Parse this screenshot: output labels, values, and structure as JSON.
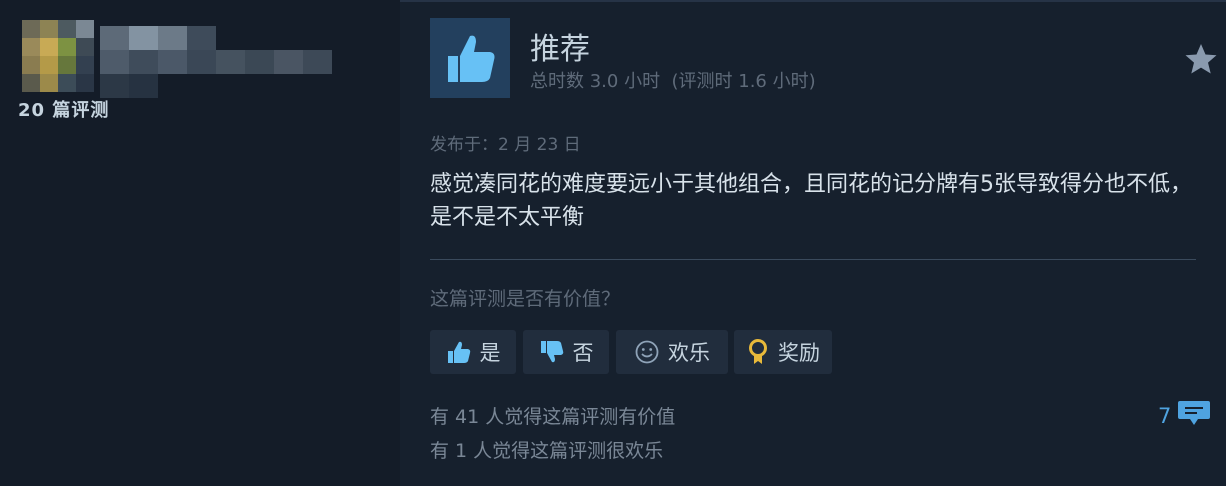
{
  "reviewer": {
    "review_count_label": "20 篇评测"
  },
  "review": {
    "verdict": "推荐",
    "playtime": "总时数 3.0 小时  (评测时 1.6 小时)",
    "posted": "发布于：2 月 23 日",
    "body": "感觉凑同花的难度要远小于其他组合，且同花的记分牌有5张导致得分也不低，是不是不太平衡"
  },
  "helpful": {
    "question": "这篇评测是否有价值？",
    "buttons": {
      "yes": "是",
      "no": "否",
      "funny": "欢乐",
      "award": "奖励"
    },
    "stats": {
      "helpful_text": "有 41 人觉得这篇评测有价值",
      "funny_text": "有 1 人觉得这篇评测很欢乐"
    },
    "comment_count": "7"
  },
  "icons": {
    "verdict": "thumbs-up-icon",
    "star": "star-icon",
    "yes": "thumbs-up-icon",
    "no": "thumbs-down-icon",
    "funny": "smiley-icon",
    "award": "award-ribbon-icon",
    "comments": "speech-bubble-icon"
  },
  "colors": {
    "background": "#16202d",
    "accent_blue": "#4fa3e0",
    "thumb_blue": "#67c1f5",
    "award_gold": "#e8b93a"
  }
}
